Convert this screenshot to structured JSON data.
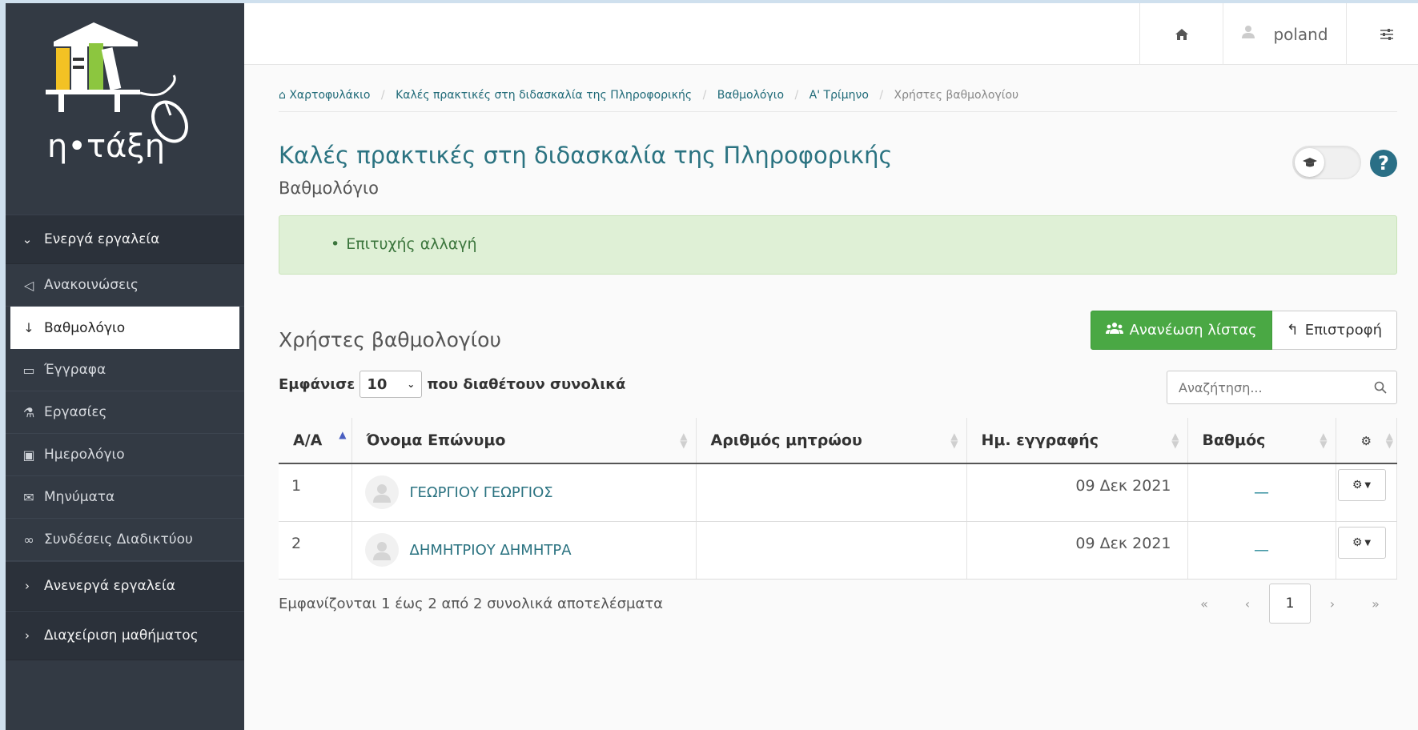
{
  "app": {
    "logo_text": "η•τάξη"
  },
  "topbar": {
    "username": "poland"
  },
  "sidebar": {
    "active_section": "Ενεργά εργαλεία",
    "items": [
      {
        "label": "Ανακοινώσεις",
        "icon": "bullhorn-icon"
      },
      {
        "label": "Βαθμολόγιο",
        "icon": "sort-numeric-icon",
        "active": true
      },
      {
        "label": "Έγγραφα",
        "icon": "folder-open-icon"
      },
      {
        "label": "Εργασίες",
        "icon": "flask-icon"
      },
      {
        "label": "Ημερολόγιο",
        "icon": "calendar-icon"
      },
      {
        "label": "Μηνύματα",
        "icon": "envelope-icon"
      },
      {
        "label": "Συνδέσεις Διαδικτύου",
        "icon": "link-icon"
      }
    ],
    "inactive_section": "Ανενεργά εργαλεία",
    "admin_section": "Διαχείριση μαθήματος"
  },
  "breadcrumb": [
    "Χαρτοφυλάκιο",
    "Καλές πρακτικές στη διδασκαλία της Πληροφορικής",
    "Βαθμολόγιο",
    "Α' Τρίμηνο",
    "Χρήστες βαθμολογίου"
  ],
  "page": {
    "title": "Καλές πρακτικές στη διδασκαλία της Πληροφορικής",
    "subtitle": "Βαθμολόγιο",
    "help": "?"
  },
  "alert": {
    "message": "Επιτυχής αλλαγή"
  },
  "section": {
    "title": "Χρήστες βαθμολογίου",
    "refresh_label": "Ανανέωση λίστας",
    "back_label": "Επιστροφή"
  },
  "table_controls": {
    "show_prefix": "Εμφάνισε",
    "page_size": "10",
    "show_suffix": "που διαθέτουν συνολικά",
    "search_placeholder": "Αναζήτηση..."
  },
  "table": {
    "columns": [
      "Α/Α",
      "Όνομα Επώνυμο",
      "Αριθμός μητρώου",
      "Ημ. εγγραφής",
      "Βαθμός"
    ],
    "rows": [
      {
        "num": "1",
        "name": "ΓΕΩΡΓΙΟΥ ΓΕΩΡΓΙΟΣ",
        "am": "",
        "date": "09 Δεκ 2021",
        "grade": "—"
      },
      {
        "num": "2",
        "name": "ΔΗΜΗΤΡΙΟΥ ΔΗΜΗΤΡΑ",
        "am": "",
        "date": "09 Δεκ 2021",
        "grade": "—"
      }
    ]
  },
  "footer": {
    "info": "Εμφανίζονται 1 έως 2 από 2 συνολικά αποτελέσματα",
    "first": "«",
    "prev": "‹",
    "current_page": "1",
    "next": "›",
    "last": "»"
  },
  "colors": {
    "sidebar_bg": "#333a44",
    "accent_teal": "#2b7381",
    "success_green": "#4aa844",
    "alert_bg": "#dff0d6"
  }
}
